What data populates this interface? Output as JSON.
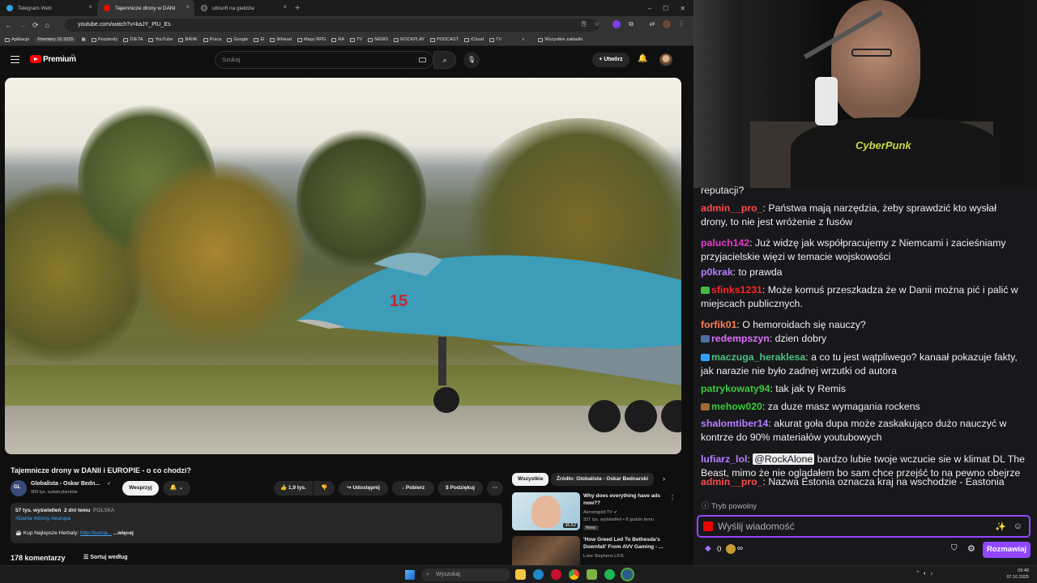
{
  "browser": {
    "tabs": [
      {
        "label": "Telegram Web",
        "active": false
      },
      {
        "label": "Tajemnicze drony w DANI",
        "active": true
      },
      {
        "label": "ubisoft na giełdzie",
        "active": false
      }
    ],
    "url": "youtube.com/watch?v=kaJY_PlU_Es",
    "bookmarks": [
      "Aplikacje",
      "Premiery 10 2025",
      "Perplexity",
      "DIETA",
      "YouTube",
      "BANK",
      "Praca",
      "Google",
      "El",
      "WHead",
      "Mapy RPG",
      "RA",
      "TV",
      "NEWS",
      "ROCKPLAY",
      "PODCAST",
      "iCloud",
      "TV"
    ],
    "bookmarks_all": "Wszystkie zakładki"
  },
  "youtube": {
    "logo": "Premium",
    "logo_suffix": "PL",
    "search_placeholder": "Szukaj",
    "create_label": "Utwórz",
    "video_title": "Tajemnicze drony w DANII i EUROPIE - o co chodzi?",
    "channel_name": "Globalista - Oskar Bedn...",
    "subscribers": "909 tys. subskrybentów",
    "support_label": "Wesprzyj",
    "likes": "1,9 tys.",
    "share_label": "Udostępnij",
    "download_label": "Pobierz",
    "thanks_label": "Podziękuj",
    "description": {
      "views": "57 tys. wyświetleń",
      "date": "2 dni temu",
      "country": "POLSKA",
      "hashtags": "#Dania #drony #europa",
      "promo_text": "Kup Najlepsze Herbaty:",
      "promo_link": "http://tuncia...",
      "more": "...więcej"
    },
    "comments_count": "178 komentarzy",
    "sort_label": "Sortuj według",
    "chips": [
      "Wszystkie",
      "Źródło: Globalista - Oskar Bednarski"
    ],
    "recommendations": [
      {
        "title": "Why does everything have ads now??",
        "channel": "Asmongold TV",
        "meta": "337 tys. wyświetleń • 8 godzin temu",
        "badge": "Nowy",
        "duration": "36:52"
      },
      {
        "title": "'How Greed Led To Bethesda's Downfall' From AVV Gaming - ...",
        "channel": "Luke Stephens LIVE",
        "meta": "",
        "badge": "",
        "duration": ""
      }
    ]
  },
  "chat": {
    "partial_top": "reputacji?",
    "messages": [
      {
        "user": "admin__pro_",
        "color": "#ff4a4a",
        "text": "Państwa mają narzędzia, żeby sprawdzić kto wysłał drony, to nie jest wróżenie z fusów"
      },
      {
        "user": "paluch142",
        "color": "#e33cc8",
        "text": "Już widzę jak współpracujemy z Niemcami i zacieśniamy przyjacielskie więzi w temacie wojskowości"
      },
      {
        "user": "p0krak",
        "color": "#b77dff",
        "text": "to prawda"
      },
      {
        "user": "sfinks1231",
        "color": "#ff2424",
        "text": "Może komuś przeszkadza że w Danii można pić i palić w miejscach publicznych."
      },
      {
        "user": "forfik01",
        "color": "#ff7f50",
        "text": "O hemoroidach się nauczy?"
      },
      {
        "user": "redempszyn",
        "color": "#e070ff",
        "text": "dzien dobry"
      },
      {
        "user": "maczuga_heraklesa",
        "color": "#4ec27f",
        "text": "a co tu jest wątpliwego? kanaał pokazuje fakty, jak narazie nie było zadnej wrzutki od autora"
      },
      {
        "user": "patrykowaty94",
        "color": "#3cc93c",
        "text": "tak jak ty Remis"
      },
      {
        "user": "mehow020",
        "color": "#3cc93c",
        "text": "za duze masz wymagania rockens"
      },
      {
        "user": "shalomtiber14",
        "color": "#b77dff",
        "text": "akurat goła dupa może zaskakująco dużo nauczyć w kontrze do 90% materiałów youtubowych"
      },
      {
        "user": "lufiarz_lol",
        "color": "#b77dff",
        "mention": "@RockAlone",
        "text": "bardzo lubie twoje wczucie sie w klimat DL The Beast, mimo że nie oglądałem bo sam chce przejść to na pewno obejrze"
      },
      {
        "user": "admin__pro_",
        "color": "#ff4a4a",
        "text": "Nazwa Estonia oznacza kraj na wschodzie - Eastonia"
      }
    ],
    "slow_mode": "Tryb powolny",
    "input_placeholder": "Wyślij wiadomość",
    "points": "0",
    "infinity": "∞",
    "send_button": "Rozmawiaj"
  },
  "camera": {
    "shirt_text": "CyberPunk"
  },
  "taskbar": {
    "search_label": "Wyszukaj",
    "time": "09:48",
    "date": "07.10.2025"
  }
}
